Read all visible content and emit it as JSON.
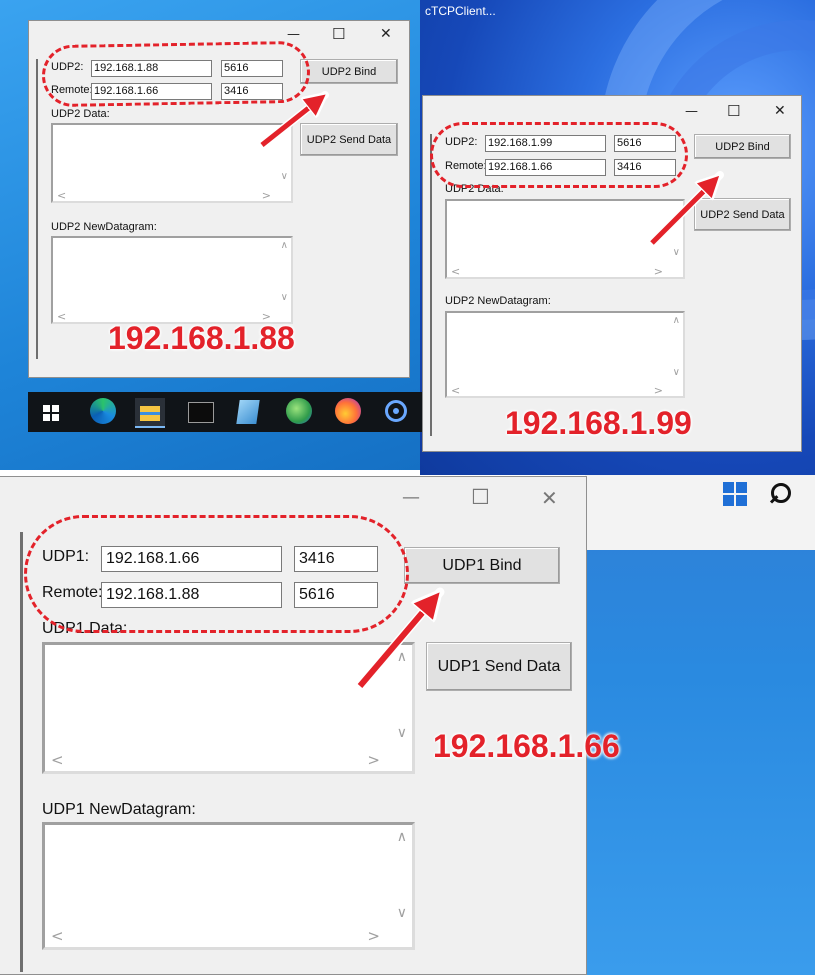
{
  "desktop": {
    "colors": {
      "win11_blue": "#1d5fd1",
      "win10_blue": "#2f9be8",
      "taskbar": "#101418",
      "accent_red": "#e3222a"
    },
    "app_title": "cTCPClient..."
  },
  "window1": {
    "udp_label": "UDP2:",
    "local_ip": "192.168.1.88",
    "local_port": "5616",
    "remote_label": "Remote:",
    "remote_ip": "192.168.1.66",
    "remote_port": "3416",
    "bind_label": "UDP2 Bind",
    "send_label": "UDP2 Send Data",
    "data_label": "UDP2 Data:",
    "newdatagram_label": "UDP2 NewDatagram:",
    "overlay_ip": "192.168.1.88"
  },
  "window2": {
    "udp_label": "UDP2:",
    "local_ip": "192.168.1.99",
    "local_port": "5616",
    "remote_label": "Remote:",
    "remote_ip": "192.168.1.66",
    "remote_port": "3416",
    "bind_label": "UDP2 Bind",
    "send_label": "UDP2 Send Data",
    "data_label": "UDP2 Data:",
    "newdatagram_label": "UDP2 NewDatagram:",
    "overlay_ip": "192.168.1.99"
  },
  "window3": {
    "udp_label": "UDP1:",
    "local_ip": "192.168.1.66",
    "local_port": "3416",
    "remote_label": "Remote:",
    "remote_ip": "192.168.1.88",
    "remote_port": "5616",
    "bind_label": "UDP1 Bind",
    "send_label": "UDP1 Send Data",
    "data_label": "UDP1 Data:",
    "newdatagram_label": "UDP1 NewDatagram:",
    "overlay_ip": "192.168.1.66"
  },
  "taskbar_icons": [
    "start-icon",
    "edge-icon",
    "file-explorer-icon",
    "terminal-icon",
    "notepad-icon",
    "globe-app-icon",
    "firefox-icon",
    "wireless-icon"
  ],
  "win11_taskbar_icons": [
    "windows11-start-icon",
    "search-icon"
  ],
  "titlebar_glyphs": {
    "minimize": "—",
    "maximize": "☐",
    "close": "✕"
  },
  "scroll_glyphs": {
    "left": "<",
    "right": ">",
    "down": "∨",
    "up": "∧"
  }
}
